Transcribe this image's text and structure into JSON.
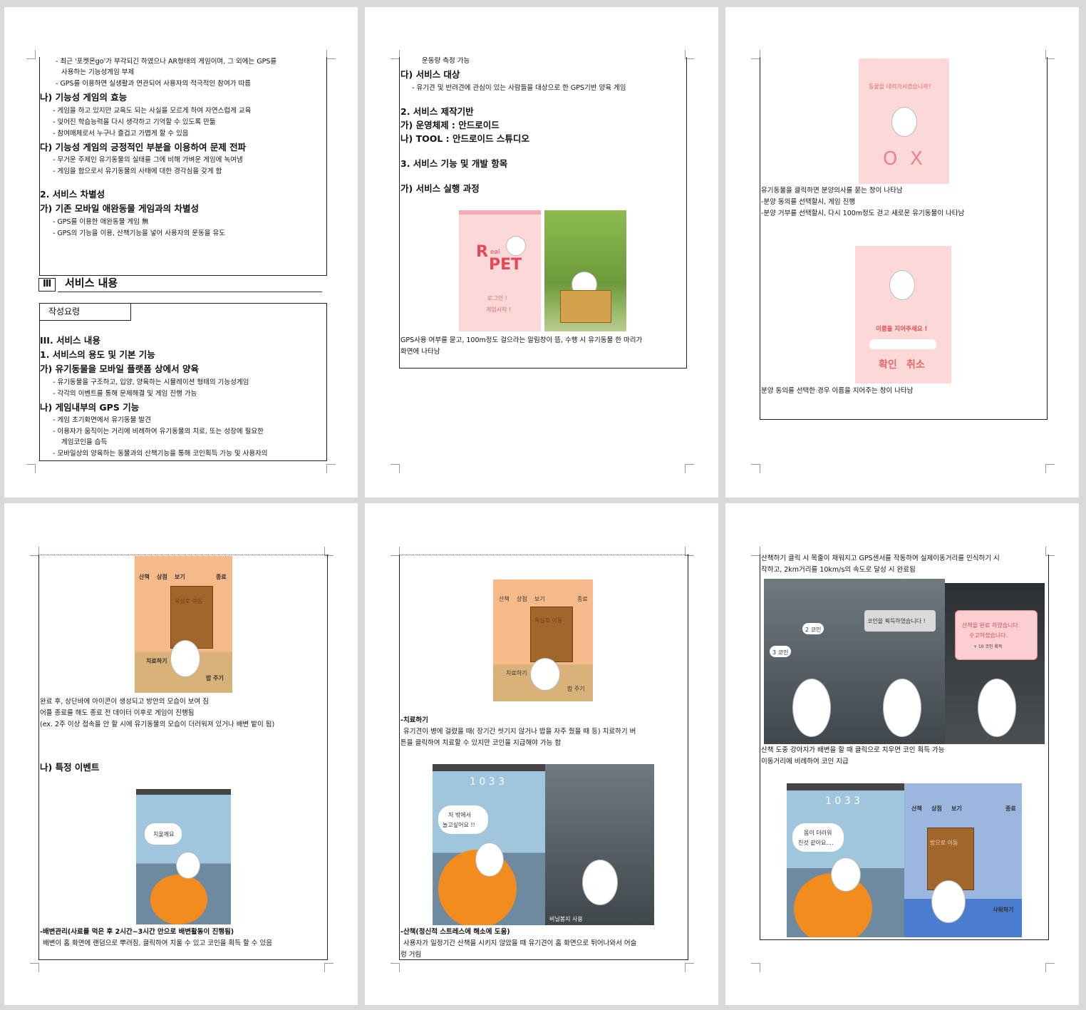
{
  "p1": {
    "lines": [
      "- 최근 '포켓몬go'가 부각되긴 하였으나 AR형태의 게임이며, 그 외에는 GPS를",
      "사용하는 기능성게임 부제",
      "- GPS를 이용하면 실생활과 연관되어 사용자의 적극적인 참여가 따름",
      "나) 기능성 게임의 효능",
      "- 게임을 하고 있지만 교육도 되는 사실을 모르게 하여 자연스럽게 교육",
      "- 잊어진 학습능력을 다시 생각하고 기억할 수 있도록 만듦",
      "- 참여매체로서 누구나 즐겁고 가볍게 할 수 있음",
      "다) 기능성 게임의 긍정적인 부분을 이용하여 문제 전파",
      "- 무거운 주제인 유기동물의 실태를 그에 비해 가벼운 게임에 녹여냄",
      "- 게임을 함으로서 유기동물의 사태에 대한 경각심을 갖게 함",
      "2. 서비스 차별성",
      "가) 기존 모바일 애완동물 게임과의 차별성",
      "- GPS를 이용한 애완동물 게임 無",
      "- GPS의 기능을 이용, 산책기능을 넣어 사용자의 운동을 유도"
    ],
    "section_num": "Ⅲ",
    "section_title": "서비스 내용",
    "guide_label": "작성요령",
    "lines2": [
      "III. 서비스 내용",
      "1. 서비스의 용도 및 기본 기능",
      "가) 유기동물을 모바일 플랫폼 상에서 양육",
      "- 유기동물을 구조하고, 입양, 양육하는 시뮬레이션 형태의 기능성게임",
      "- 각각의 이벤트를 통해 문제해결 및 게임 진행 가능",
      "나) 게임내부의 GPS 기능",
      "- 게임 초기화면에서 유기동물 발견",
      "- 이용자가 움직이는 거리에 비례하여 유기동물의 치료, 또는 성장에 필요한",
      "게임코인을 습득",
      "- 모바일상의 양육하는 동물과의 산책기능을 통해 코인획득 가능 및 사용자의"
    ]
  },
  "p2": {
    "lines": [
      "운동량 측정 가능",
      "다) 서비스 대상",
      "- 유기견 및 반려견에 관심이 있는 사람들을 대상으로 한 GPS기반 양육 게임",
      "2. 서비스 제작기반",
      "가) 운영체제 : 안드로이드",
      "나) TOOL : 안드로이드 스튜디오",
      "3. 서비스 기능 및 개발 항목",
      "가) 서비스 실행 과정"
    ],
    "logo_r": "R",
    "logo_eal": "eal",
    "logo_pet": "PET",
    "login1": "로그인 !",
    "login2": "게임시작 !",
    "caption1": "GPS사용 여부를 묻고, 100m정도 걸으라는 알림창이 뜸, 수행 시 유기동물 한 마리가",
    "caption2": "화면에 나타남"
  },
  "p3": {
    "q": "동물을 데려가시겠습니까?",
    "o": "O",
    "x": "X",
    "lines": [
      "유기동물을 클릭하면 분양의사를 묻는 창이 나타남",
      "-분양 동의를 선택할시, 게임 진행",
      "-분양 거부를 선택할시, 다시 100m정도 걷고 새로운 유기동물이 나타남"
    ],
    "name_prompt": "이름을 지어주세요 !",
    "ok": "확인",
    "cancel": "취소",
    "caption": "분양 동의를 선택한 경우 이름을 지어주는 창이 나타남"
  },
  "p4": {
    "menu": [
      "산책",
      "상점",
      "보기",
      "종료"
    ],
    "door": "욕실로 이동",
    "heal": "치료하기",
    "feed": "밥 주기",
    "lines": [
      "완료 후, 상단바에 아이콘이 생성되고 방안의 모습이 보여 짐",
      "어플 종료를 해도 종료 전 데이터 이후로 게임이 진행됨",
      "(ex. 2주 이상 접속을 안 할 시에 유기동물의 모습이 더러워져 있거나 배변 밭이 됨)"
    ],
    "event": "나) 특정 이벤트",
    "bubble": "치울께요",
    "cap1": "-배변관리(사료를 먹은 후 2시간~3시간 안으로 배변활동이 진행됨)",
    "cap2": "배변이 홈 화면에 랜덤으로 뿌려짐, 클릭하여 치울 수 있고 코인을 획득 할 수 있음"
  },
  "p5": {
    "menu": [
      "산책",
      "상점",
      "보기",
      "종료"
    ],
    "door": "욕실로 이동",
    "heal": "치료하기",
    "feed": "밥 주기",
    "heal_title": "-치료하기",
    "heal_1": "유기견이 병에 걸렸을 때( 장기간 씻기지 않거나 밥을 자주 줬을 때 등) 치료하기 버",
    "heal_2": "튼을 클릭하여 치료할 수 있지만 코인을 지급해야 가능 함",
    "clock": "1 0 3 3",
    "bubble1": "저 밖에서",
    "bubble2": "놀고싶어요 !!",
    "bag": "비닐봉지 사용",
    "walk_title": "-산책(정신적 스트레스에 해소에 도움)",
    "walk_1": "사용자가 일정기간 산책을 시키지 않았을 때 유기견이 홈 화면으로 튀어나와서 어슬",
    "walk_2": "렁 거림"
  },
  "p6": {
    "l1": "산책하기 클릭 시 목줄이 채워지고 GPS센서를 작동하여 실제이동거리를 인식하기 시",
    "l2": "작하고, 2km거리를 10km/s의 속도로 달성 시 완료됨",
    "coin3": "3 코인",
    "coin2": "2 코인",
    "got": "코인을 획득하였습니다 !",
    "done1": "산책을 완료 하였습니다.",
    "done2": "수고하셨습니다.",
    "done3": "+ 10 코인 획득",
    "l3": "산책 도중 강아지가 배변을 할 때 클릭으로 치우면 코인 획득 가능",
    "l4": "이동거리에 비례하여 코인 지급",
    "clock": "1 0 3 3",
    "bubble1": "몸이 더러워",
    "bubble2": "진것 같아요....",
    "menu": [
      "산책",
      "상점",
      "보기",
      "종료"
    ],
    "door": "방으로 이동",
    "shower": "샤워하기"
  },
  "colors": {
    "pink": "#fdd8d8",
    "red": "#e34a55",
    "rose": "#f08f9d"
  }
}
